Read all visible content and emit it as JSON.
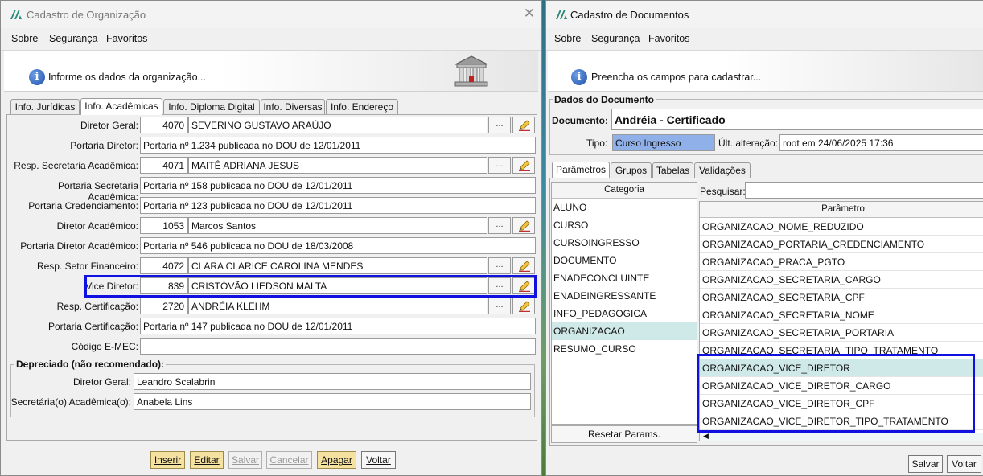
{
  "left_window": {
    "title": "Cadastro de Organização",
    "menu": [
      "Sobre",
      "Segurança",
      "Favoritos"
    ],
    "header_text": "Informe os dados da organização...",
    "tabs": [
      "Info. Jurídicas",
      "Info. Acadêmicas",
      "Info. Diploma Digital",
      "Info. Diversas",
      "Info. Endereço"
    ],
    "active_tab": "Info. Acadêmicas",
    "rows": [
      {
        "label": "Diretor Geral:",
        "code": "4070",
        "value": "SEVERINO GUSTAVO ARAÚJO",
        "buttons": true
      },
      {
        "label": "Portaria Diretor:",
        "value": "Portaria nº 1.234 publicada no DOU de 12/01/2011"
      },
      {
        "label": "Resp. Secretaria Acadêmica:",
        "code": "4071",
        "value": "MAITÊ ADRIANA JESUS",
        "buttons": true
      },
      {
        "label": "Portaria Secretaria Acadêmica:",
        "value": "Portaria nº 158 publicada no DOU de 12/01/2011"
      },
      {
        "label": "Portaria Credenciamento:",
        "value": "Portaria nº 123 publicada no DOU de 12/01/2011"
      },
      {
        "label": "Diretor Acadêmico:",
        "code": "1053",
        "value": "Marcos Santos",
        "buttons": true
      },
      {
        "label": "Portaria Diretor Acadêmico:",
        "value": "Portaria nº 546 publicada no DOU de 18/03/2008"
      },
      {
        "label": "Resp. Setor Financeiro:",
        "code": "4072",
        "value": "CLARA CLARICE CAROLINA MENDES",
        "buttons": true
      },
      {
        "label": "Vice Diretor:",
        "code": "839",
        "value": "CRISTÓVÃO LIEDSON MALTA",
        "buttons": true
      },
      {
        "label": "Resp. Certificação:",
        "code": "2720",
        "value": "ANDRÉIA KLEHM",
        "buttons": true
      },
      {
        "label": "Portaria Certificação:",
        "value": "Portaria nº 147 publicada no DOU de 12/01/2011"
      },
      {
        "label": "Código E-MEC:",
        "value": ""
      }
    ],
    "dots_label": "...",
    "deprecated": {
      "title": "Depreciado (não recomendado):",
      "rows": [
        {
          "label": "Diretor Geral:",
          "value": "Leandro Scalabrin"
        },
        {
          "label": "Secretária(o) Acadêmica(o):",
          "value": "Anabela Lins"
        }
      ]
    },
    "buttons": {
      "inserir": "Inserir",
      "editar": "Editar",
      "salvar": "Salvar",
      "cancelar": "Cancelar",
      "apagar": "Apagar",
      "voltar": "Voltar"
    }
  },
  "right_window": {
    "title": "Cadastro de Documentos",
    "menu": [
      "Sobre",
      "Segurança",
      "Favoritos"
    ],
    "header_text": "Preencha os campos para cadastrar...",
    "group_title": "Dados do Documento",
    "documento_label": "Documento:",
    "documento_value": "Andréia - Certificado",
    "tipo_label": "Tipo:",
    "tipo_value": "Curso Ingresso",
    "ult_label": "Últ. alteração:",
    "ult_value": "root em 24/06/2025 17:36",
    "tabs": [
      "Parâmetros",
      "Grupos",
      "Tabelas",
      "Validações"
    ],
    "active_tab": "Parâmetros",
    "categoria_header": "Categoria",
    "categorias": [
      "ALUNO",
      "CURSO",
      "CURSOINGRESSO",
      "DOCUMENTO",
      "ENADECONCLUINTE",
      "ENADEINGRESSANTE",
      "INFO_PEDAGOGICA",
      "ORGANIZACAO",
      "RESUMO_CURSO"
    ],
    "selected_categoria": "ORGANIZACAO",
    "pesquisar_label": "Pesquisar:",
    "pesquisar_value": "",
    "parametro_header": "Parâmetro",
    "parametros": [
      "ORGANIZACAO_NOME_REDUZIDO",
      "ORGANIZACAO_PORTARIA_CREDENCIAMENTO",
      "ORGANIZACAO_PRACA_PGTO",
      "ORGANIZACAO_SECRETARIA_CARGO",
      "ORGANIZACAO_SECRETARIA_CPF",
      "ORGANIZACAO_SECRETARIA_NOME",
      "ORGANIZACAO_SECRETARIA_PORTARIA",
      "ORGANIZACAO_SECRETARIA_TIPO_TRATAMENTO",
      "ORGANIZACAO_VICE_DIRETOR",
      "ORGANIZACAO_VICE_DIRETOR_CARGO",
      "ORGANIZACAO_VICE_DIRETOR_CPF",
      "ORGANIZACAO_VICE_DIRETOR_TIPO_TRATAMENTO"
    ],
    "selected_parametro": "ORGANIZACAO_VICE_DIRETOR",
    "reset_label": "Resetar Params.",
    "salvar_label": "Salvar",
    "voltar_label": "Voltar"
  }
}
